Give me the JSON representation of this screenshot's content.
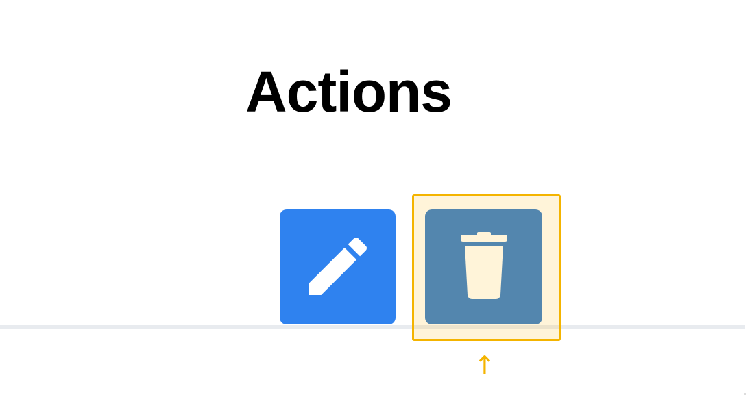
{
  "header": {
    "title": "Actions"
  },
  "buttons": {
    "edit": {
      "icon": "pencil-icon",
      "color": "#2f82ef"
    },
    "delete": {
      "icon": "trash-icon",
      "color": "#2e79cb"
    }
  },
  "annotation": {
    "highlight_color": "#f4b400",
    "arrow_glyph": "↑",
    "target": "delete-button"
  }
}
